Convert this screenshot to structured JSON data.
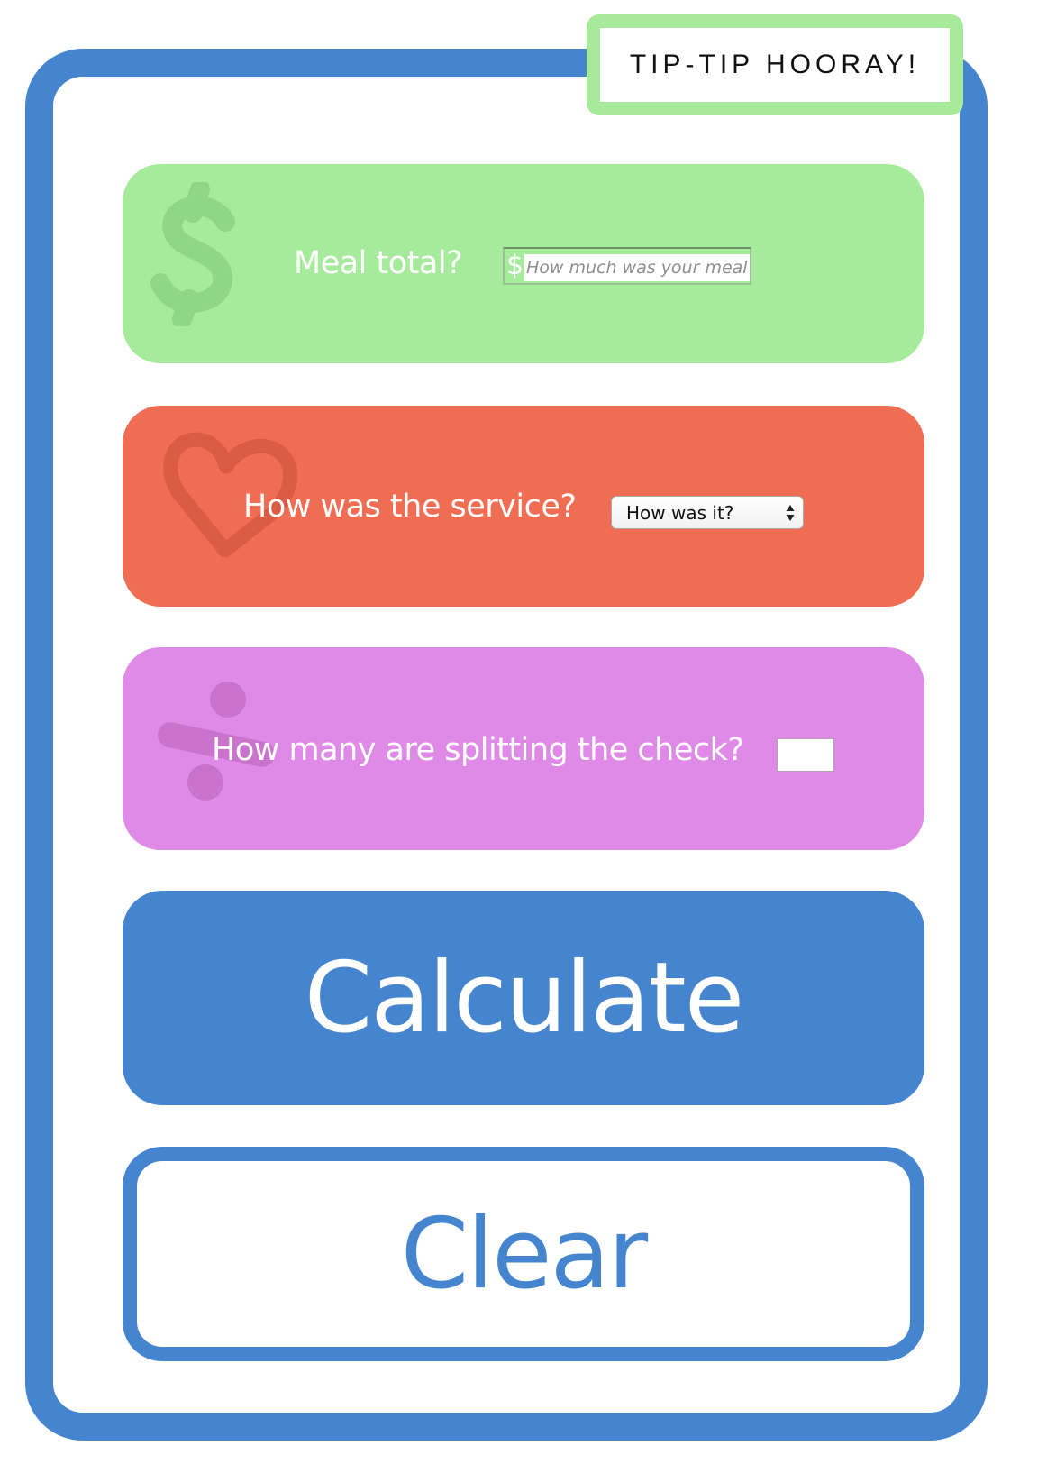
{
  "app": {
    "title": "TIP-TIP HOORAY!"
  },
  "meal": {
    "label": "Meal total?",
    "currency_symbol": "$",
    "placeholder": "How much was your meal?",
    "value": "",
    "icon": "dollar-icon"
  },
  "service": {
    "label": "How was the service?",
    "selected_option": "How was it?",
    "icon": "heart-icon"
  },
  "split": {
    "label": "How many are splitting the check?",
    "value": "",
    "icon": "divide-icon"
  },
  "actions": {
    "calculate_label": "Calculate",
    "clear_label": "Clear"
  },
  "colors": {
    "primary_blue": "#4584cf",
    "meal_green": "#a6eb9b",
    "service_red": "#ef6d52",
    "split_purple": "#de8ae6"
  }
}
